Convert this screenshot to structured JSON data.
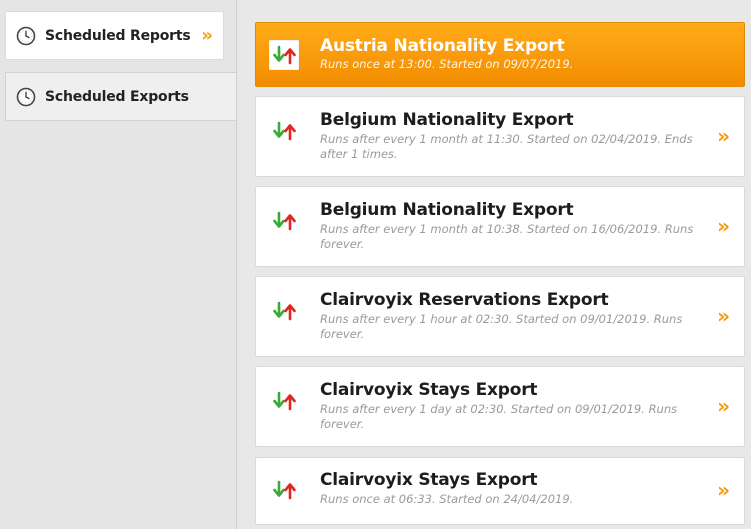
{
  "colors": {
    "accent": "#f39c12",
    "active_card": "#f7940a",
    "arrow_down": "#3aa93a",
    "arrow_up": "#e0261e"
  },
  "sidebar": {
    "items": [
      {
        "label": "Scheduled Reports",
        "icon": "clock-icon",
        "has_chevron": true,
        "selected": false
      },
      {
        "label": "Scheduled Exports",
        "icon": "clock-icon",
        "has_chevron": false,
        "selected": true
      }
    ],
    "chevron_glyph": "»"
  },
  "exports": {
    "chevron_glyph": "»",
    "items": [
      {
        "title": "Austria Nationality Export",
        "description": "Runs once at 13:00. Started on 09/07/2019.",
        "icon": "sort-arrows-icon",
        "active": true
      },
      {
        "title": "Belgium Nationality Export",
        "description": "Runs after every 1 month at 11:30. Started on 02/04/2019. Ends after 1 times.",
        "icon": "sort-arrows-icon",
        "active": false
      },
      {
        "title": "Belgium Nationality Export",
        "description": "Runs after every 1 month at 10:38. Started on 16/06/2019. Runs forever.",
        "icon": "sort-arrows-icon",
        "active": false
      },
      {
        "title": "Clairvoyix Reservations Export",
        "description": "Runs after every 1 hour at 02:30. Started on 09/01/2019. Runs forever.",
        "icon": "sort-arrows-icon",
        "active": false
      },
      {
        "title": "Clairvoyix Stays Export",
        "description": "Runs after every 1 day at 02:30. Started on 09/01/2019. Runs forever.",
        "icon": "sort-arrows-icon",
        "active": false
      },
      {
        "title": "Clairvoyix Stays Export",
        "description": "Runs once at 06:33. Started on 24/04/2019.",
        "icon": "sort-arrows-icon",
        "active": false
      }
    ]
  }
}
